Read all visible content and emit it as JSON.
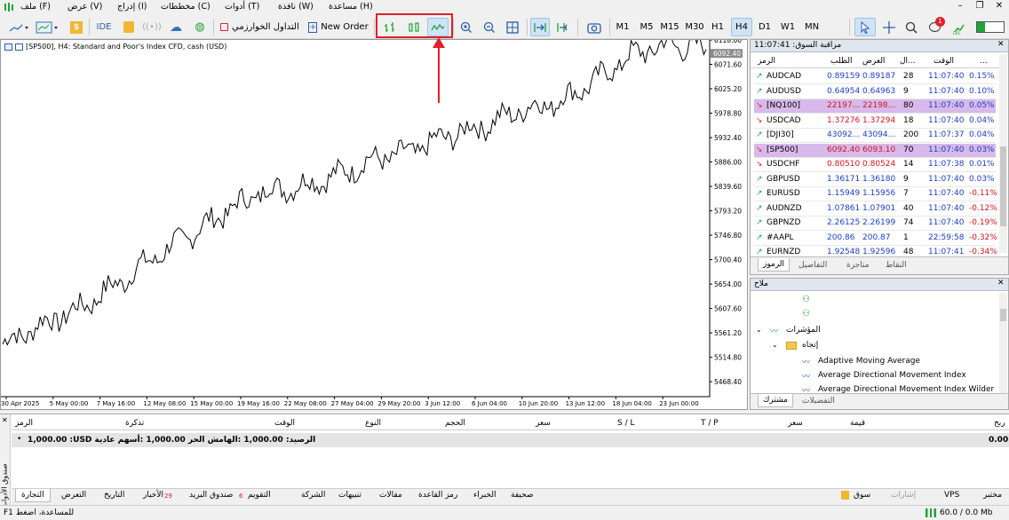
{
  "menu": [
    "ملف (F)",
    "عرض (V)",
    "إدراج (I)",
    "مخططات (C)",
    "أدوات (T)",
    "نافذة (W)",
    "مساعدة (H)"
  ],
  "toolbar": {
    "ide_label": "IDE",
    "algo_label": "التداول الخوارزمي",
    "new_order_label": "New Order",
    "timeframes": [
      "M1",
      "M5",
      "M15",
      "M30",
      "H1",
      "H4",
      "D1",
      "W1",
      "MN"
    ],
    "active_timeframe": "H4",
    "notification_count": "1"
  },
  "chart": {
    "title": "[SP500], H4:  Standard and Poor's Index CFD, cash (USD)",
    "price_labels": [
      "6118.00",
      "6071.60",
      "6025.20",
      "5978.80",
      "5932.40",
      "5886.00",
      "5839.60",
      "5793.20",
      "5746.80",
      "5700.40",
      "5654.00",
      "5607.60",
      "5561.20",
      "5514.80",
      "5468.40"
    ],
    "current_price": "6092.40",
    "time_labels": [
      "30 Apr 2025",
      "5 May 00:00",
      "7 May 16:00",
      "12 May 08:00",
      "15 May 00:00",
      "19 May 16:00",
      "22 May 08:00",
      "27 May 04:00",
      "29 May 20:00",
      "3 Jun 12:00",
      "6 Jun 04:00",
      "10 Jun 20:00",
      "13 Jun 12:00",
      "18 Jun 04:00",
      "23 Jun 00:00"
    ],
    "accent": "#e0202a"
  },
  "chart_data": {
    "type": "line",
    "title": "[SP500], H4:  Standard and Poor's Index CFD, cash (USD)",
    "ylim": [
      5440,
      6118
    ],
    "x": [
      "30 Apr 2025",
      "5 May 00:00",
      "7 May 16:00",
      "12 May 08:00",
      "15 May 00:00",
      "19 May 16:00",
      "22 May 08:00",
      "27 May 04:00",
      "29 May 20:00",
      "3 Jun 12:00",
      "6 Jun 04:00",
      "10 Jun 20:00",
      "13 Jun 12:00",
      "18 Jun 04:00",
      "23 Jun 00:00"
    ],
    "series": [
      {
        "values": [
          5540,
          5575,
          5605,
          5650,
          5700,
          5745,
          5790,
          5830,
          5840,
          5860,
          5890,
          5905,
          5935,
          5955,
          5985,
          6000,
          6040,
          6090,
          6110,
          6100
        ]
      }
    ]
  },
  "watch": {
    "title": "مراقبة السوق: 11:07:41",
    "headers": [
      "الرمز",
      "الطلب",
      "العرض",
      "ال...",
      "الوقت",
      "..."
    ],
    "rows": [
      {
        "sym": "AUDCAD",
        "bid": "0.89159",
        "ask": "0.89187",
        "sp": "28",
        "time": "11:07:40",
        "chg": "0.15%",
        "dir": "up",
        "hl": ""
      },
      {
        "sym": "AUDUSD",
        "bid": "0.64954",
        "ask": "0.64963",
        "sp": "9",
        "time": "11:07:40",
        "chg": "0.10%",
        "dir": "up",
        "hl": ""
      },
      {
        "sym": "[NQ100]",
        "bid": "22197...",
        "ask": "22198...",
        "sp": "80",
        "time": "11:07:40",
        "chg": "0.05%",
        "dir": "down",
        "hl": "#d7b9ea"
      },
      {
        "sym": "USDCAD",
        "bid": "1.37276",
        "ask": "1.37294",
        "sp": "18",
        "time": "11:07:40",
        "chg": "0.04%",
        "dir": "down",
        "hl": ""
      },
      {
        "sym": "[DJI30]",
        "bid": "43092...",
        "ask": "43094...",
        "sp": "200",
        "time": "11:07:37",
        "chg": "0.04%",
        "dir": "up",
        "hl": ""
      },
      {
        "sym": "[SP500]",
        "bid": "6092.40",
        "ask": "6093.10",
        "sp": "70",
        "time": "11:07:40",
        "chg": "0.03%",
        "dir": "down",
        "hl": "#d7b9ea"
      },
      {
        "sym": "USDCHF",
        "bid": "0.80510",
        "ask": "0.80524",
        "sp": "14",
        "time": "11:07:38",
        "chg": "0.01%",
        "dir": "down",
        "hl": ""
      },
      {
        "sym": "GBPUSD",
        "bid": "1.36171",
        "ask": "1.36180",
        "sp": "9",
        "time": "11:07:40",
        "chg": "0.03%",
        "dir": "up",
        "hl": ""
      },
      {
        "sym": "EURUSD",
        "bid": "1.15949",
        "ask": "1.15956",
        "sp": "7",
        "time": "11:07:40",
        "chg": "-0.11%",
        "dir": "up",
        "hl": ""
      },
      {
        "sym": "AUDNZD",
        "bid": "1.07861",
        "ask": "1.07901",
        "sp": "40",
        "time": "11:07:40",
        "chg": "-0.12%",
        "dir": "up",
        "hl": ""
      },
      {
        "sym": "GBPNZD",
        "bid": "2.26125",
        "ask": "2.26199",
        "sp": "74",
        "time": "11:07:40",
        "chg": "-0.19%",
        "dir": "up",
        "hl": ""
      },
      {
        "sym": "#AAPL",
        "bid": "200.86",
        "ask": "200.87",
        "sp": "1",
        "time": "22:59:58",
        "chg": "-0.32%",
        "dir": "up",
        "hl": ""
      },
      {
        "sym": "EURNZD",
        "bid": "1.92548",
        "ask": "1.92596",
        "sp": "48",
        "time": "11:07:41",
        "chg": "-0.34%",
        "dir": "up",
        "hl": ""
      }
    ],
    "tabs": [
      "الرموز",
      "التفاصيل",
      "متاجرة",
      "النقاط"
    ]
  },
  "nav": {
    "title": "ملاح",
    "indicators": "المؤشرات",
    "trend": "إتجاه",
    "items": [
      "Adaptive Moving Average",
      "Average Directional Movement Index",
      "Average Directional Movement Index Wilder"
    ],
    "tabs": [
      "مشترك",
      "التفضيلات"
    ]
  },
  "toolbox": {
    "headers_left": [
      "الرمز",
      "تذكرة",
      "الوقت",
      "النوع",
      "الحجم",
      "سعر",
      "S / L",
      "T / P"
    ],
    "headers_right": [
      "سعر",
      "قيمة",
      "ربح"
    ],
    "balance_line": "1,000.00 :USD الرصيد:  1,000.00 :الهامش الحر  1,000.00 :أسهم عادية",
    "profit": "0.00",
    "side_label": "صندوق الأدوات",
    "tabs": [
      "التجارة",
      "التعرض",
      "التاريخ",
      "الأخبار",
      "صندوق البريد",
      "التقويم",
      "الشركة",
      "تنبيهات",
      "مقالات",
      "رمز القاعدة",
      "الخبراء",
      "صحيفة"
    ],
    "news_count": "29",
    "mail_count": "6",
    "right_items": [
      "سوق",
      "إشارات",
      "VPS",
      "مختبر"
    ]
  },
  "status": {
    "left": "للمساعدة، اضغط F1",
    "right": "60.0 / 0.0 Mb"
  }
}
